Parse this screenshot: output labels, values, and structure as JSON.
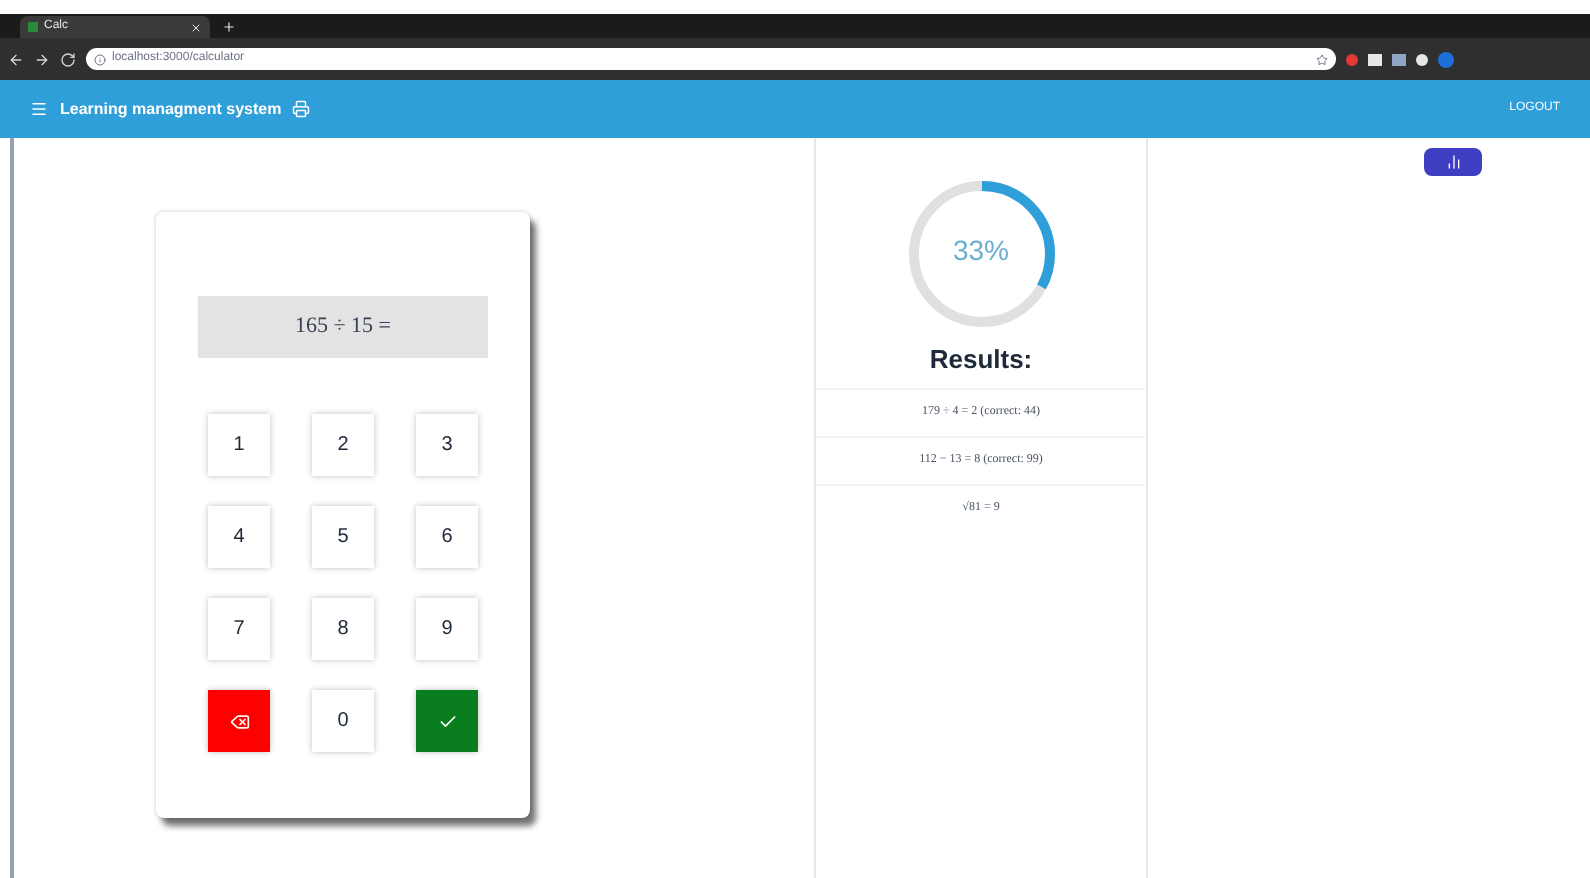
{
  "browser": {
    "tab_title": "Calc",
    "url": "localhost:3000/calculator"
  },
  "app_bar": {
    "title": "Learning managment system",
    "logout": "LOGOUT"
  },
  "calculator": {
    "expression": "165 ÷ 15 =",
    "keys": [
      {
        "label": "1",
        "kind": "digit"
      },
      {
        "label": "2",
        "kind": "digit"
      },
      {
        "label": "3",
        "kind": "digit"
      },
      {
        "label": "4",
        "kind": "digit"
      },
      {
        "label": "5",
        "kind": "digit"
      },
      {
        "label": "6",
        "kind": "digit"
      },
      {
        "label": "7",
        "kind": "digit"
      },
      {
        "label": "8",
        "kind": "digit"
      },
      {
        "label": "9",
        "kind": "digit"
      },
      {
        "kind": "delete"
      },
      {
        "label": "0",
        "kind": "digit"
      },
      {
        "kind": "submit"
      }
    ]
  },
  "results": {
    "progress": {
      "label": "33%"
    },
    "title": "Results:",
    "items": [
      "179 ÷ 4 = 2 (correct: 44)",
      "112 − 13 = 8 (correct: 99)",
      "√81 = 9"
    ]
  }
}
